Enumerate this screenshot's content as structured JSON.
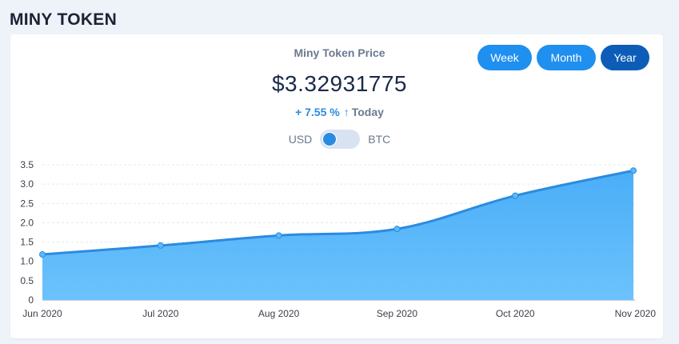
{
  "header": {
    "title": "MINY TOKEN"
  },
  "price_card": {
    "label": "Miny Token Price",
    "price": "$3.32931775",
    "change_pct": "+ 7.55 %",
    "change_arrow": "↑",
    "change_period": "Today",
    "currency_left": "USD",
    "currency_right": "BTC",
    "toggle_state": "USD"
  },
  "range_buttons": {
    "week": "Week",
    "month": "Month",
    "year": "Year",
    "selected": "Year"
  },
  "colors": {
    "accent": "#1f8ff0",
    "accent_dark": "#0d5db8",
    "area_fill": "#5bb8fa",
    "line": "#2b8be0"
  },
  "chart_data": {
    "type": "area",
    "categories": [
      "Jun 2020",
      "Jul 2020",
      "Aug 2020",
      "Sep 2020",
      "Oct 2020",
      "Nov 2020"
    ],
    "series": [
      {
        "values": [
          1.18,
          1.41,
          1.67,
          1.84,
          2.7,
          3.35
        ]
      }
    ],
    "ylim": [
      0,
      3.5
    ],
    "yticks": [
      "0",
      "0.5",
      "1.0",
      "1.5",
      "2.0",
      "2.5",
      "3.0",
      "3.5"
    ],
    "grid": true
  }
}
